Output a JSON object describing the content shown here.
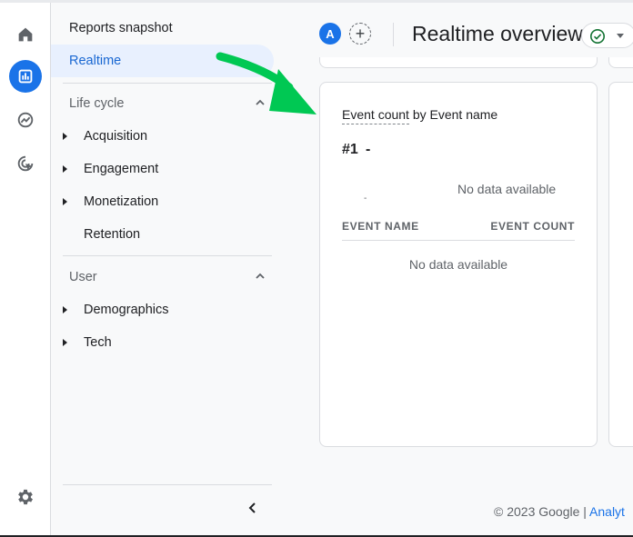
{
  "rail": {
    "items": [
      {
        "name": "home-icon"
      },
      {
        "name": "reports-icon",
        "active": true
      },
      {
        "name": "explore-icon"
      },
      {
        "name": "advertising-icon"
      }
    ],
    "settings": "settings-icon"
  },
  "nav": {
    "reports_snapshot": "Reports snapshot",
    "realtime": "Realtime",
    "lifecycle": {
      "title": "Life cycle",
      "items": [
        "Acquisition",
        "Engagement",
        "Monetization",
        "Retention"
      ]
    },
    "user": {
      "title": "User",
      "items": [
        "Demographics",
        "Tech"
      ]
    }
  },
  "header": {
    "avatar_letter": "A",
    "add_symbol": "+",
    "title": "Realtime overview"
  },
  "card": {
    "metric": "Event count",
    "dimension": " by Event name",
    "rank": "#1",
    "rank_value": "-",
    "mini_dash": "-",
    "no_data": "No data available",
    "col_event_name": "EVENT NAME",
    "col_event_count": "EVENT COUNT",
    "table_no_data": "No data available"
  },
  "footer": {
    "copyright": "© 2023 Google | ",
    "link": "Analyt"
  },
  "colors": {
    "accent": "#1a73e8",
    "selected_bg": "#e8f0fe",
    "arrow": "#00c853"
  }
}
